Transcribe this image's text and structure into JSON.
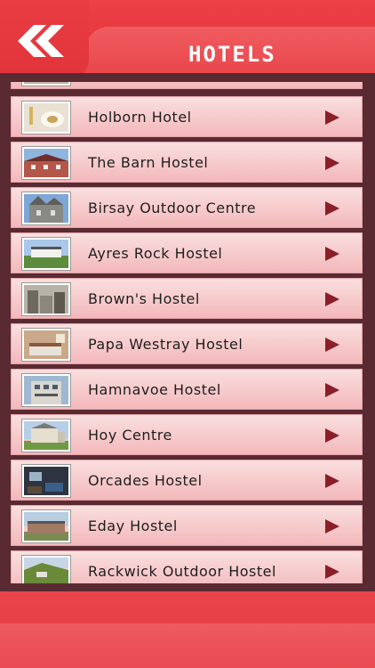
{
  "header": {
    "title": "HOTELS"
  },
  "list": {
    "items": [
      {
        "label": "",
        "thumb": "partial-thumbnail"
      },
      {
        "label": "Holborn Hotel",
        "thumb": "food-plate"
      },
      {
        "label": "The Barn Hostel",
        "thumb": "barn-building"
      },
      {
        "label": "Birsay Outdoor Centre",
        "thumb": "stone-house"
      },
      {
        "label": "Ayres Rock Hostel",
        "thumb": "cottage"
      },
      {
        "label": "Brown's Hostel",
        "thumb": "street-houses"
      },
      {
        "label": "Papa Westray Hostel",
        "thumb": "bedroom"
      },
      {
        "label": "Hamnavoe Hostel",
        "thumb": "town-building"
      },
      {
        "label": "Hoy Centre",
        "thumb": "farmhouse"
      },
      {
        "label": "Orcades Hostel",
        "thumb": "lounge"
      },
      {
        "label": "Eday Hostel",
        "thumb": "long-building"
      },
      {
        "label": "Rackwick Outdoor Hostel",
        "thumb": "hillside"
      }
    ]
  },
  "colors": {
    "accent": "#e83a3f",
    "frame": "#5a2a33",
    "row_top": "#fadfdf",
    "row_bottom": "#f3b8bb",
    "chevron": "#8a1f29"
  }
}
